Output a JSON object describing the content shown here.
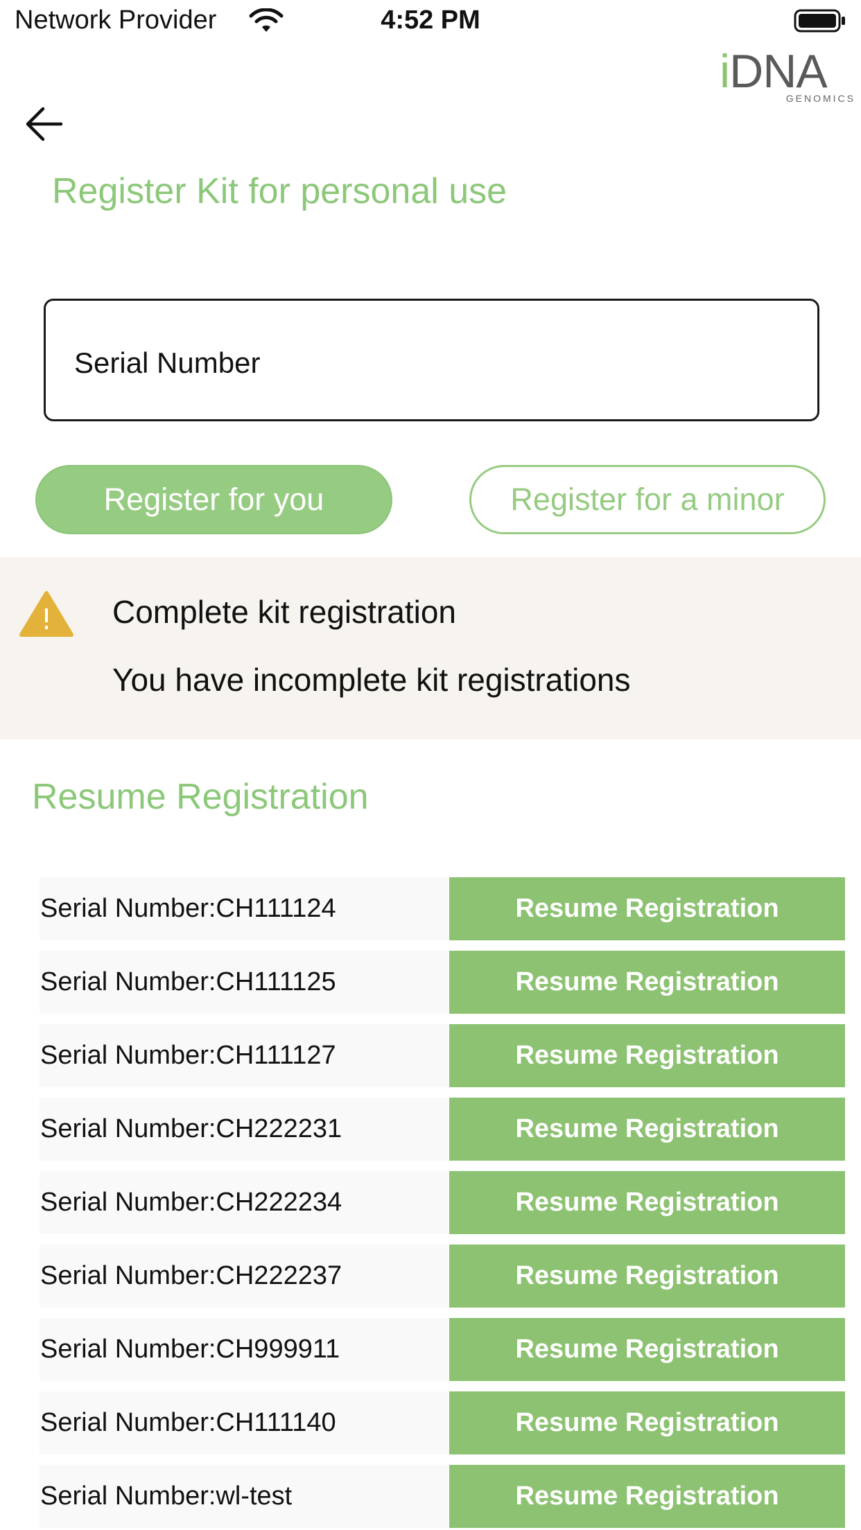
{
  "status_bar": {
    "carrier": "Network Provider",
    "time": "4:52 PM"
  },
  "logo": {
    "accent": "i",
    "word": "DNA",
    "sub": "GENOMICS"
  },
  "page": {
    "title": "Register Kit for personal use"
  },
  "serial_input": {
    "placeholder": "Serial Number"
  },
  "buttons": {
    "register_you": "Register for you",
    "register_minor": "Register for a minor"
  },
  "banner": {
    "title": "Complete kit registration",
    "message": "You have incomplete kit registrations"
  },
  "resume": {
    "section_title": "Resume Registration",
    "items": [
      {
        "label": "Serial Number:CH111124",
        "button": "Resume Registration"
      },
      {
        "label": "Serial Number:CH111125",
        "button": "Resume Registration"
      },
      {
        "label": "Serial Number:CH111127",
        "button": "Resume Registration"
      },
      {
        "label": "Serial Number:CH222231",
        "button": "Resume Registration"
      },
      {
        "label": "Serial Number:CH222234",
        "button": "Resume Registration"
      },
      {
        "label": "Serial Number:CH222237",
        "button": "Resume Registration"
      },
      {
        "label": "Serial Number:CH999911",
        "button": "Resume Registration"
      },
      {
        "label": "Serial Number:CH111140",
        "button": "Resume Registration"
      },
      {
        "label": "Serial Number:wl-test",
        "button": "Resume Registration"
      }
    ]
  },
  "colors": {
    "accent_green": "#8cc879",
    "button_green": "#8cc271",
    "banner_bg": "#f7f4ef",
    "warning_yellow": "#e2b23a"
  }
}
